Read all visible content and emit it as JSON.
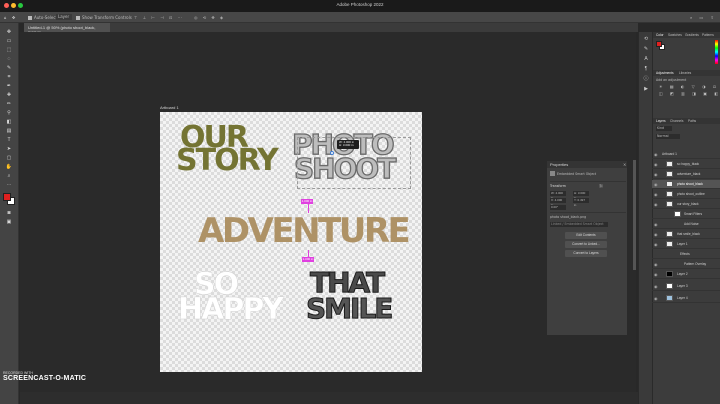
{
  "app_title": "Adobe Photoshop 2022",
  "options_bar": {
    "auto_select": "Auto-Select:",
    "layer_dropdown": "Layer",
    "show_transform": "Show Transform Controls"
  },
  "document_tab": "Untitled-1 @ 50% (photo shoot_black, RGB/8)",
  "artboard_label": "Artboard 1",
  "artwork": {
    "our": "OUR",
    "story": "STORY",
    "photo": "PHOTO",
    "shoot": "SHOOT",
    "adventure": "ADVENTURE",
    "so": "SO",
    "happy": "HAPPY",
    "that": "THAT",
    "smile": "SMILE"
  },
  "canvas_tooltip": {
    "line1": "W: 4.000 in",
    "line2": "H: 3.000 in"
  },
  "guide_labels": [
    "1.000 in",
    "1.000 in"
  ],
  "properties_panel": {
    "title": "Properties",
    "type": "Embedded Smart Object",
    "section": "Transform",
    "w_field": "W: 4.000 in",
    "h_field": "H: 3.000 in",
    "x_field": "X: 4.000 in",
    "y_field": "Y: 0.497 in",
    "angle_field": "0.00°",
    "filename": "photo shoot_black.png",
    "source_note": "Linked / Embedded Smart Object",
    "buttons": [
      "Edit Contents",
      "Convert to Linked...",
      "Convert to Layers"
    ]
  },
  "right_panels": {
    "color_tabs": [
      "Color",
      "Swatches",
      "Gradients",
      "Patterns"
    ],
    "adjust_tabs": [
      "Adjustments",
      "Libraries"
    ],
    "adjust_hint": "Add an adjustment",
    "layer_tabs": [
      "Layers",
      "Channels",
      "Paths"
    ],
    "kind_filter": "Kind",
    "blend_mode": "Normal",
    "layers": [
      "Artboard 1",
      "so happy_black",
      "adventure_black",
      "photo shoot_black",
      "photo shoot_outline",
      "our story_black",
      "Smart Filters",
      "Add Noise",
      "that smile_black",
      "Layer 1",
      "Effects",
      "Pattern Overlay",
      "Layer 2",
      "Layer 3",
      "Layer 4"
    ]
  },
  "watermark": {
    "small": "RECORDED WITH",
    "big": "SCREENCAST-O-MATIC"
  },
  "colors": {
    "foreground": "#e0201f",
    "background": "#ffffff",
    "olive": "#747433",
    "tan": "#ae9266",
    "accent": "#e040e0"
  }
}
